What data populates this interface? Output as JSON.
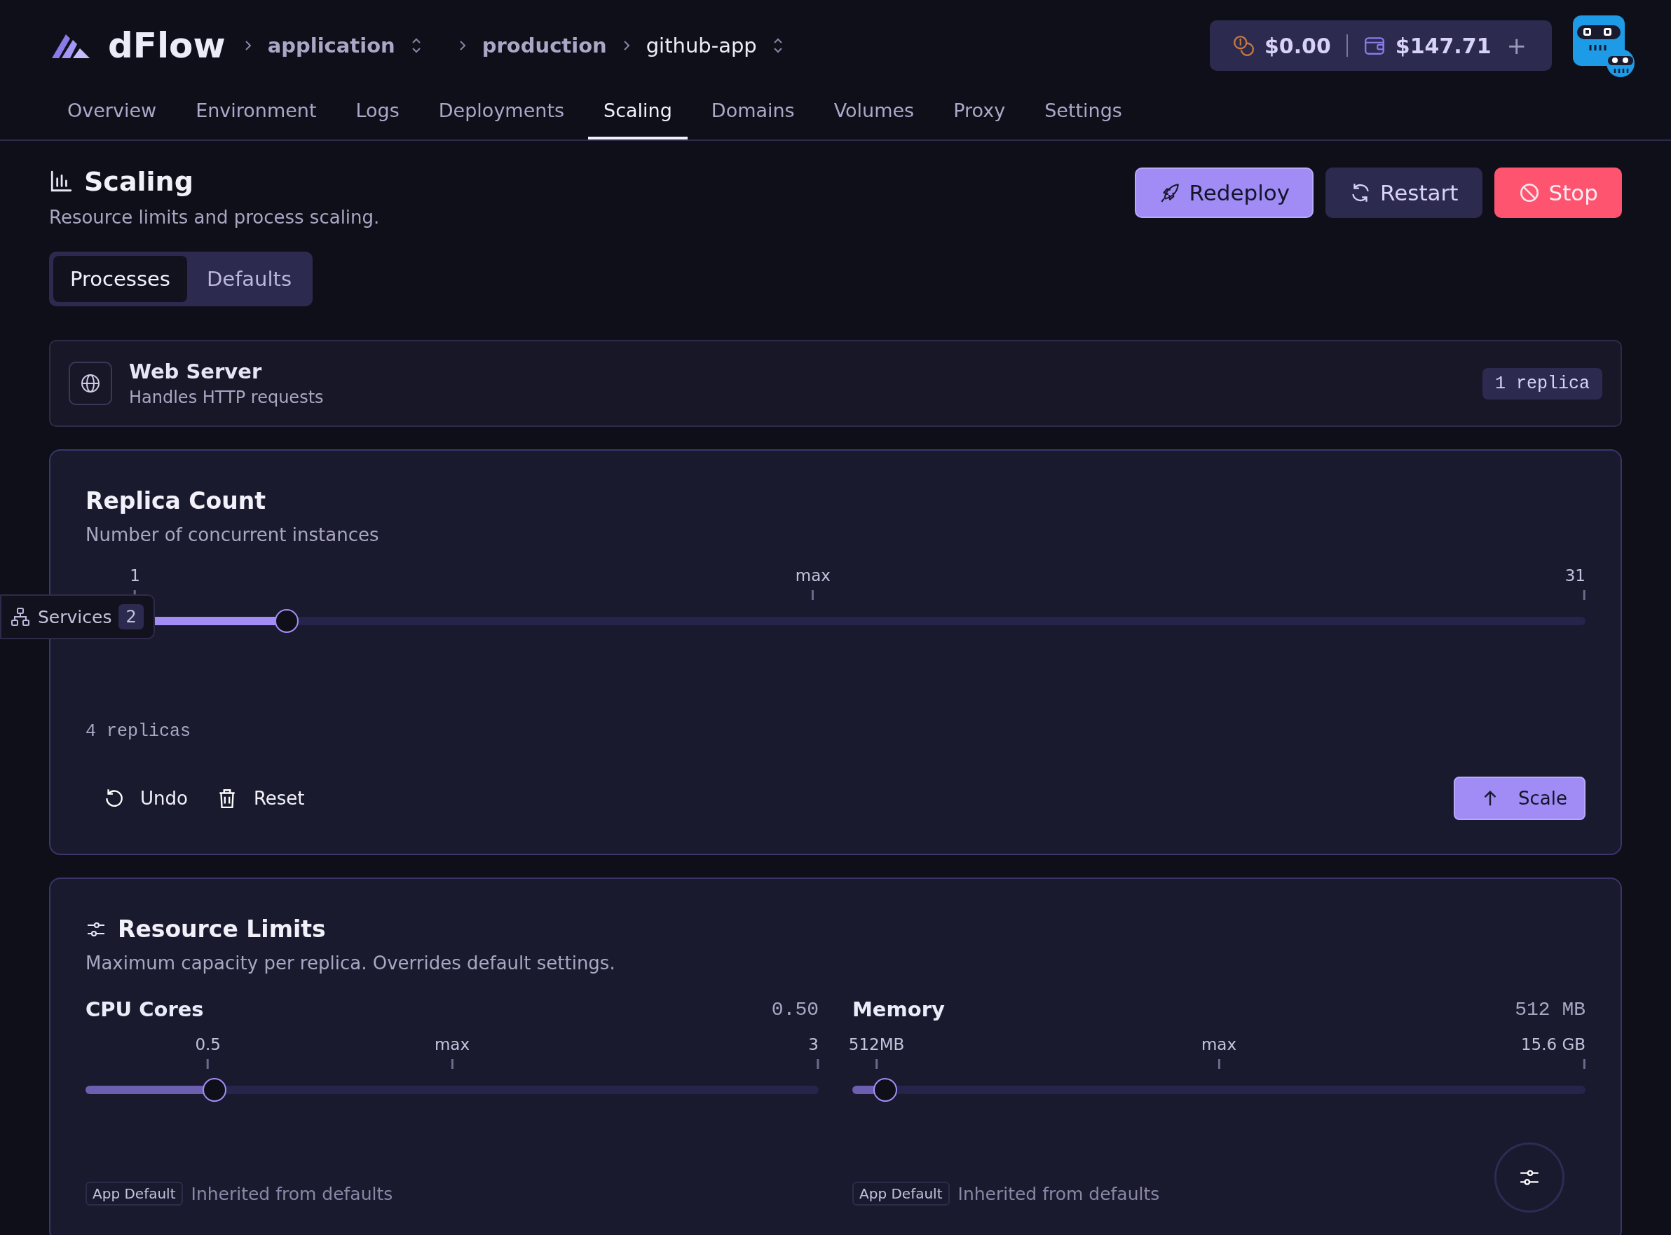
{
  "header": {
    "logo": "dFlow",
    "breadcrumbs": [
      {
        "label": "application",
        "switcher": true,
        "current": false
      },
      {
        "label": "production",
        "switcher": false,
        "current": false
      },
      {
        "label": "github-app",
        "switcher": true,
        "current": true
      }
    ],
    "credits": {
      "free": "$0.00",
      "wallet": "$147.71",
      "add": "+"
    }
  },
  "tabs": [
    {
      "label": "Overview",
      "selected": false
    },
    {
      "label": "Environment",
      "selected": false
    },
    {
      "label": "Logs",
      "selected": false
    },
    {
      "label": "Deployments",
      "selected": false
    },
    {
      "label": "Scaling",
      "selected": true
    },
    {
      "label": "Domains",
      "selected": false
    },
    {
      "label": "Volumes",
      "selected": false
    },
    {
      "label": "Proxy",
      "selected": false
    },
    {
      "label": "Settings",
      "selected": false
    }
  ],
  "page": {
    "title": "Scaling",
    "subtitle": "Resource limits and process scaling.",
    "actions": [
      {
        "label": "Redeploy",
        "kind": "primary"
      },
      {
        "label": "Restart",
        "kind": "secondary"
      },
      {
        "label": "Stop",
        "kind": "danger"
      }
    ]
  },
  "subtabs": [
    {
      "label": "Processes",
      "selected": true
    },
    {
      "label": "Defaults",
      "selected": false
    }
  ],
  "process": {
    "name": "Web Server",
    "description": "Handles HTTP requests",
    "badge": "1 replica"
  },
  "replicas": {
    "title": "Replica Count",
    "subtitle": "Number of concurrent instances",
    "marks": [
      "1",
      "max",
      "31"
    ],
    "level": 0.134,
    "value": "4 replicas",
    "actions": [
      {
        "label": "Undo",
        "kind": "undo"
      },
      {
        "label": "Reset",
        "kind": "reset"
      }
    ],
    "submit": "Scale"
  },
  "services_chip": {
    "label": "Services",
    "count": "2"
  },
  "limits": {
    "title": "Resource Limits",
    "subtitle": "Maximum capacity per replica. Overrides default settings.",
    "sliders": [
      {
        "name": "CPU Cores",
        "reading": "0.50",
        "marks": [
          "0.5",
          "max",
          "3"
        ],
        "level": 0.176,
        "tag": "App Default",
        "note": "Inherited from defaults"
      },
      {
        "name": "Memory",
        "reading": "512 MB",
        "marks": [
          "512MB",
          "max",
          "15.6 GB"
        ],
        "level": 0.045,
        "tag": "App Default",
        "note": "Inherited from defaults"
      }
    ]
  }
}
